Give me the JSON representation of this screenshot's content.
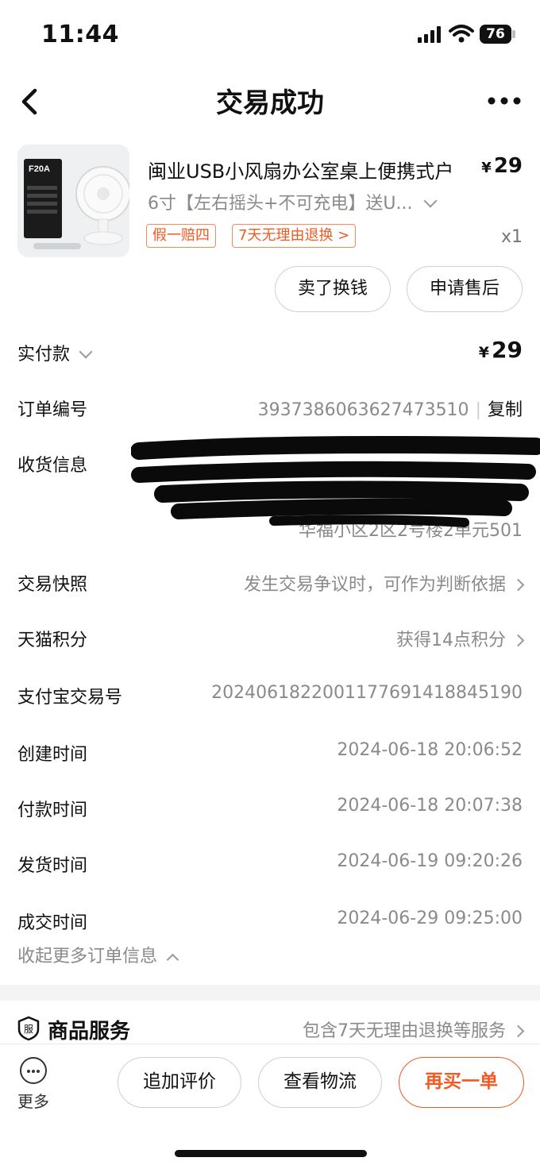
{
  "status_bar": {
    "time": "11:44",
    "battery": "76"
  },
  "nav": {
    "title": "交易成功"
  },
  "product": {
    "title": "闽业USB小风扇办公室桌上便携式户",
    "price_symbol": "¥",
    "price": "29",
    "spec": "6寸【左右摇头+不可充电】送U...",
    "tags": [
      "假一赔四",
      "7天无理由退换 >"
    ],
    "quantity": "x1",
    "thumb_text": "F20A"
  },
  "actions_top": {
    "sell": "卖了换钱",
    "after_sale": "申请售后"
  },
  "order": {
    "paid_label": "实付款",
    "paid_symbol": "¥",
    "paid_value": "29",
    "order_no_label": "订单编号",
    "order_no": "3937386063627473510",
    "copy_label": "复制",
    "shipping_label": "收货信息",
    "shipping_addr_tail": "华福小区2区2号楼2单元501",
    "snapshot_label": "交易快照",
    "snapshot_value": "发生交易争议时，可作为判断依据",
    "points_label": "天猫积分",
    "points_value": "获得14点积分",
    "alipay_label": "支付宝交易号",
    "alipay_value": "2024061822001177691418845190",
    "created_label": "创建时间",
    "created_value": "2024-06-18 20:06:52",
    "paid_time_label": "付款时间",
    "paid_time_value": "2024-06-18 20:07:38",
    "shipped_label": "发货时间",
    "shipped_value": "2024-06-19 09:20:26",
    "deal_label": "成交时间",
    "deal_value": "2024-06-29 09:25:00",
    "collapse_label": "收起更多订单信息"
  },
  "service": {
    "icon_text": "服",
    "title": "商品服务",
    "value": "包含7天无理由退换等服务"
  },
  "bottom": {
    "more": "更多",
    "review": "追加评价",
    "logistics": "查看物流",
    "rebuy": "再买一单"
  },
  "colors": {
    "accent": "#f15a22",
    "muted": "#8a8a8a"
  }
}
